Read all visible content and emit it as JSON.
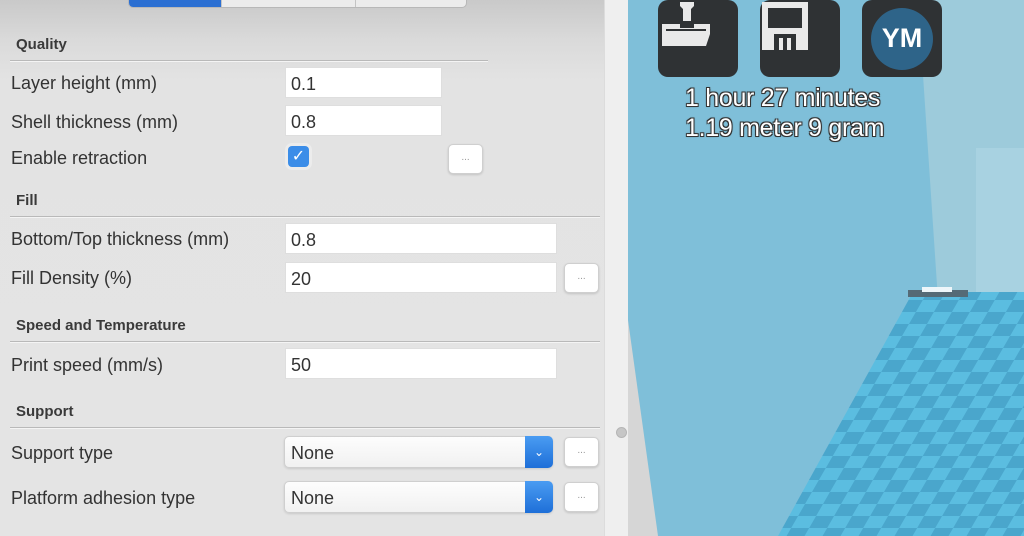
{
  "panel": {
    "tabs": [
      {
        "label": "",
        "active": true
      },
      {
        "label": "",
        "active": false
      },
      {
        "label": "",
        "active": false
      }
    ],
    "sections": {
      "quality": {
        "title": "Quality",
        "layer_height": {
          "label": "Layer height (mm)",
          "value": "0.1"
        },
        "shell_thickness": {
          "label": "Shell thickness (mm)",
          "value": "0.8"
        },
        "enable_retraction": {
          "label": "Enable retraction",
          "checked": true,
          "check_glyph": "✓",
          "more_label": "..."
        }
      },
      "fill": {
        "title": "Fill",
        "bottom_top_thickness": {
          "label": "Bottom/Top thickness (mm)",
          "value": "0.8"
        },
        "fill_density": {
          "label": "Fill Density (%)",
          "value": "20",
          "more_label": "..."
        }
      },
      "speed": {
        "title": "Speed and Temperature",
        "print_speed": {
          "label": "Print speed (mm/s)",
          "value": "50"
        }
      },
      "support": {
        "title": "Support",
        "support_type": {
          "label": "Support type",
          "value": "None",
          "more_label": "..."
        },
        "platform_adhesion": {
          "label": "Platform adhesion type",
          "value": "None",
          "more_label": "..."
        }
      }
    },
    "accent_color": "#2b6fd2"
  },
  "viewport": {
    "toolbar": {
      "load_icon": "load-model-icon",
      "save_icon": "floppy-disk-icon",
      "ym_label": "YM"
    },
    "print_time": "1 hour 27 minutes",
    "material_usage": "1.19 meter 9 gram",
    "background_color": "#7fbfd9"
  }
}
